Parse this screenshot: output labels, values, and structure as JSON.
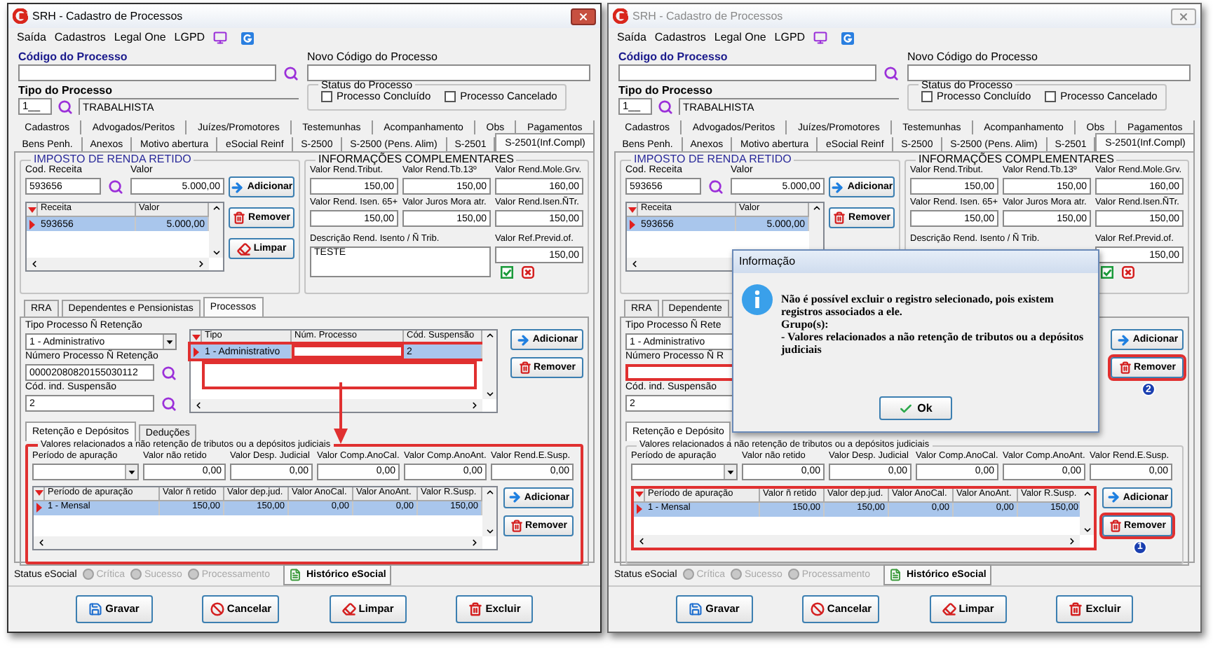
{
  "windows": [
    {
      "title": "SRH - Cadastro de Processos",
      "active": true,
      "arrow": true,
      "menu": [
        "Saída",
        "Cadastros",
        "Legal One",
        "LGPD"
      ],
      "codigo": {
        "label": "Código do Processo"
      },
      "novo_codigo": {
        "label": "Novo Código do Processo"
      },
      "tipo": {
        "label": "Tipo do Processo",
        "code": "1__",
        "name": "TRABALHISTA"
      },
      "status_processo": {
        "title": "Status do Processo",
        "options": [
          {
            "label": "Processo Concluído",
            "checked": false
          },
          {
            "label": "Processo Cancelado",
            "checked": false
          }
        ]
      },
      "tab_rows": [
        {
          "tabs": [
            {
              "label": "Cadastros",
              "selected": false
            },
            {
              "label": "Advogados/Peritos",
              "selected": false
            },
            {
              "label": "Juízes/Promotores",
              "selected": false
            },
            {
              "label": "Testemunhas",
              "selected": false
            },
            {
              "label": "Acompanhamento",
              "selected": false
            },
            {
              "label": "Obs",
              "selected": false
            },
            {
              "label": "Pagamentos",
              "selected": false
            }
          ]
        },
        {
          "tabs": [
            {
              "label": "Bens Penh.",
              "selected": false
            },
            {
              "label": "Anexos",
              "selected": false
            },
            {
              "label": "Motivo abertura",
              "selected": false
            },
            {
              "label": "eSocial Reinf",
              "selected": false
            },
            {
              "label": "S-2500",
              "selected": false
            },
            {
              "label": "S-2500 (Pens. Alim)",
              "selected": false
            },
            {
              "label": "S-2501",
              "selected": false
            },
            {
              "label": "S-2501(Inf.Compl)",
              "selected": true
            }
          ]
        }
      ],
      "ir": {
        "title": "IMPOSTO DE RENDA RETIDO",
        "fields": [
          {
            "label": "Cod. Receita",
            "value": "593656"
          },
          {
            "label": "Valor",
            "value": "5.000,00"
          }
        ],
        "grid": {
          "columns": [
            "Receita",
            "Valor"
          ],
          "rows": [
            {
              "cells": [
                "593656",
                "5.000,00"
              ],
              "selected": true
            }
          ]
        },
        "buttons": [
          {
            "kind": "add",
            "label": "Adicionar"
          },
          {
            "kind": "remove",
            "label": "Remover"
          },
          {
            "kind": "clear",
            "label": "Limpar"
          }
        ]
      },
      "info": {
        "title": "INFORMAÇÕES COMPLEMENTARES",
        "fields": [
          {
            "label": "Valor Rend.Tribut.",
            "value": "150,00"
          },
          {
            "label": "Valor Rend.Tb.13º",
            "value": "150,00"
          },
          {
            "label": "Valor Rend.Mole.Grv.",
            "value": "160,00"
          },
          {
            "label": "Valor Rend. Isen. 65+",
            "value": "150,00"
          },
          {
            "label": "Valor Juros Mora atr.",
            "value": "150,00"
          },
          {
            "label": "Valor Rend.Isen.ÑTr.",
            "value": "150,00"
          }
        ],
        "descricao": {
          "label": "Descrição Rend. Isento / Ñ Trib.",
          "value": "TESTE"
        },
        "previd": {
          "label": "Valor Ref.Previd.of.",
          "value": "150,00"
        }
      },
      "subtabs": [
        {
          "label": "RRA",
          "selected": false
        },
        {
          "label": "Dependentes e Pensionistas",
          "selected": false
        },
        {
          "label": "Processos",
          "selected": true
        }
      ],
      "processos": {
        "fields": [
          {
            "kind": "combo",
            "label": "Tipo Processo Ñ Retenção",
            "value": "1 - Administrativo",
            "highlighted": false
          },
          {
            "kind": "search",
            "label": "Número Processo Ñ Retenção",
            "value": "00002080820155030112",
            "highlighted": false
          },
          {
            "kind": "search",
            "label": "Cód. ind. Suspensão",
            "value": "2",
            "highlighted": false
          }
        ],
        "grid": {
          "columns": [
            "Tipo",
            "Núm. Processo",
            "Cód. Suspensão"
          ],
          "highlighted": false,
          "empty_highlighted": true,
          "rows": [
            {
              "cells": [
                "1 - Administrativo",
                null,
                "2"
              ],
              "selected": true,
              "highlighted": true
            }
          ]
        },
        "buttons": [
          {
            "kind": "add",
            "label": "Adicionar"
          },
          {
            "kind": "remove",
            "label": "Remover",
            "highlighted": false
          }
        ]
      },
      "inner_tabs": [
        {
          "label": "Retenção e Depósitos",
          "selected": true
        },
        {
          "label": "Deduções",
          "selected": false
        }
      ],
      "valores": {
        "title": "Valores relacionados a não retenção de tributos ou a depósitos judiciais",
        "highlighted": true,
        "fields": [
          {
            "kind": "combo",
            "label": "Período de apuração"
          },
          {
            "kind": "text",
            "label": "Valor não retido",
            "value": "0,00"
          },
          {
            "kind": "text",
            "label": "Valor Desp. Judicial",
            "value": "0,00"
          },
          {
            "kind": "text",
            "label": "Valor Comp.AnoCal.",
            "value": "0,00"
          },
          {
            "kind": "text",
            "label": "Valor Comp.AnoAnt.",
            "value": "0,00"
          },
          {
            "kind": "text",
            "label": "Valor Rend.E.Susp.",
            "value": "0,00"
          }
        ],
        "grid": {
          "columns": [
            "Período de apuração",
            "Valor ñ retido",
            "Valor dep.jud.",
            "Valor AnoCal.",
            "Valor AnoAnt.",
            "Valor R.Susp."
          ],
          "highlighted": false,
          "rows": [
            {
              "cells": [
                "1 - Mensal",
                "150,00",
                "150,00",
                "0,00",
                "0,00",
                "150,00"
              ],
              "selected": true,
              "highlighted": false
            }
          ]
        },
        "buttons": [
          {
            "kind": "add",
            "label": "Adicionar"
          },
          {
            "kind": "remove",
            "label": "Remover",
            "highlighted": false
          }
        ]
      },
      "esocial": {
        "label": "Status eSocial",
        "options": [
          {
            "label": "Crítica",
            "disabled": true
          },
          {
            "label": "Sucesso",
            "disabled": true
          },
          {
            "label": "Processamento",
            "disabled": true
          }
        ],
        "history": "Histórico eSocial"
      },
      "footer": [
        {
          "kind": "save",
          "label": "Gravar"
        },
        {
          "kind": "cancel",
          "label": "Cancelar"
        },
        {
          "kind": "clear",
          "label": "Limpar"
        },
        {
          "kind": "delete",
          "label": "Excluir"
        }
      ]
    },
    {
      "title": "SRH - Cadastro de Processos",
      "active": false,
      "arrow": false,
      "menu": [
        "Saída",
        "Cadastros",
        "Legal One",
        "LGPD"
      ],
      "codigo": {
        "label": "Código do Processo"
      },
      "novo_codigo": {
        "label": "Novo Código do Processo"
      },
      "tipo": {
        "label": "Tipo do Processo",
        "code": "1__",
        "name": "TRABALHISTA"
      },
      "status_processo": {
        "title": "Status do Processo",
        "options": [
          {
            "label": "Processo Concluído",
            "checked": false
          },
          {
            "label": "Processo Cancelado",
            "checked": false
          }
        ]
      },
      "tab_rows": [
        {
          "tabs": [
            {
              "label": "Cadastros",
              "selected": false
            },
            {
              "label": "Advogados/Peritos",
              "selected": false
            },
            {
              "label": "Juízes/Promotores",
              "selected": false
            },
            {
              "label": "Testemunhas",
              "selected": false
            },
            {
              "label": "Acompanhamento",
              "selected": false
            },
            {
              "label": "Obs",
              "selected": false
            },
            {
              "label": "Pagamentos",
              "selected": false
            }
          ]
        },
        {
          "tabs": [
            {
              "label": "Bens Penh.",
              "selected": false
            },
            {
              "label": "Anexos",
              "selected": false
            },
            {
              "label": "Motivo abertura",
              "selected": false
            },
            {
              "label": "eSocial Reinf",
              "selected": false
            },
            {
              "label": "S-2500",
              "selected": false
            },
            {
              "label": "S-2500 (Pens. Alim)",
              "selected": false
            },
            {
              "label": "S-2501",
              "selected": false
            },
            {
              "label": "S-2501(Inf.Compl)",
              "selected": true
            }
          ]
        }
      ],
      "ir": {
        "title": "IMPOSTO DE RENDA RETIDO",
        "fields": [
          {
            "label": "Cod. Receita",
            "value": "593656"
          },
          {
            "label": "Valor",
            "value": "5.000,00"
          }
        ],
        "grid": {
          "columns": [
            "Receita",
            "Valor"
          ],
          "rows": [
            {
              "cells": [
                "593656",
                "5.000,00"
              ],
              "selected": true
            }
          ]
        },
        "buttons": [
          {
            "kind": "add",
            "label": "Adicionar"
          },
          {
            "kind": "remove",
            "label": "Remover"
          }
        ]
      },
      "info": {
        "title": "INFORMAÇÕES COMPLEMENTARES",
        "fields": [
          {
            "label": "Valor Rend.Tribut.",
            "value": "150,00"
          },
          {
            "label": "Valor Rend.Tb.13º",
            "value": "150,00"
          },
          {
            "label": "Valor Rend.Mole.Grv.",
            "value": "160,00"
          },
          {
            "label": "Valor Rend. Isen. 65+",
            "value": "150,00"
          },
          {
            "label": "Valor Juros Mora atr.",
            "value": "150,00"
          },
          {
            "label": "Valor Rend.Isen.ÑTr.",
            "value": "150,00"
          }
        ],
        "descricao": {
          "label": "Descrição Rend. Isento / Ñ Trib."
        },
        "previd": {
          "label": "Valor Ref.Previd.of.",
          "value": "150,00"
        }
      },
      "subtabs": [
        {
          "label": "RRA",
          "selected": false
        },
        {
          "label": "Dependente",
          "selected": false
        }
      ],
      "processos": {
        "fields": [
          {
            "kind": "text",
            "label": "Tipo Processo Ñ Rete",
            "value": "1 - Administrativo",
            "highlighted": false
          },
          {
            "kind": "text",
            "label": "Número Processo Ñ R",
            "highlighted": true
          },
          {
            "kind": "text",
            "label": "Cód. ind. Suspensão",
            "value": "2",
            "highlighted": false
          }
        ],
        "buttons": [
          {
            "kind": "add",
            "label": "Adicionar"
          },
          {
            "kind": "remove",
            "label": "Remover",
            "highlighted": true,
            "badge": "2"
          }
        ]
      },
      "inner_tabs": [
        {
          "label": "Retenção e Depósito",
          "selected": true
        }
      ],
      "valores": {
        "title": "Valores relacionados a não retenção de tributos ou a depósitos judiciais",
        "highlighted": false,
        "fields": [
          {
            "kind": "combo",
            "label": "Período de apuração"
          },
          {
            "kind": "text",
            "label": "Valor não retido",
            "value": "0,00"
          },
          {
            "kind": "text",
            "label": "Valor Desp. Judicial",
            "value": "0,00"
          },
          {
            "kind": "text",
            "label": "Valor Comp.AnoCal.",
            "value": "0,00"
          },
          {
            "kind": "text",
            "label": "Valor Comp.AnoAnt.",
            "value": "0,00"
          },
          {
            "kind": "text",
            "label": "Valor Rend.E.Susp.",
            "value": "0,00"
          }
        ],
        "grid": {
          "columns": [
            "Período de apuração",
            "Valor ñ retido",
            "Valor dep.jud.",
            "Valor AnoCal.",
            "Valor AnoAnt.",
            "Valor R.Susp."
          ],
          "highlighted": true,
          "rows": [
            {
              "cells": [
                "1 - Mensal",
                "150,00",
                "150,00",
                "0,00",
                "0,00",
                "150,00"
              ],
              "selected": true,
              "highlighted": false
            }
          ]
        },
        "buttons": [
          {
            "kind": "add",
            "label": "Adicionar"
          },
          {
            "kind": "remove",
            "label": "Remover",
            "highlighted": true,
            "badge": "1"
          }
        ]
      },
      "esocial": {
        "label": "Status eSocial",
        "options": [
          {
            "label": "Crítica",
            "disabled": true
          },
          {
            "label": "Sucesso",
            "disabled": true
          },
          {
            "label": "Processamento",
            "disabled": true
          }
        ],
        "history": "Histórico eSocial"
      },
      "footer": [
        {
          "kind": "save",
          "label": "Gravar"
        },
        {
          "kind": "cancel",
          "label": "Cancelar"
        },
        {
          "kind": "clear",
          "label": "Limpar"
        },
        {
          "kind": "delete",
          "label": "Excluir"
        }
      ],
      "dialog": {
        "title": "Informação",
        "lines": [
          "Não é possível excluir o registro selecionado, pois existem registros associados a ele.",
          "Grupo(s):",
          "- Valores relacionados a não retenção de tributos ou a depósitos judiciais"
        ],
        "button": "Ok"
      }
    }
  ]
}
